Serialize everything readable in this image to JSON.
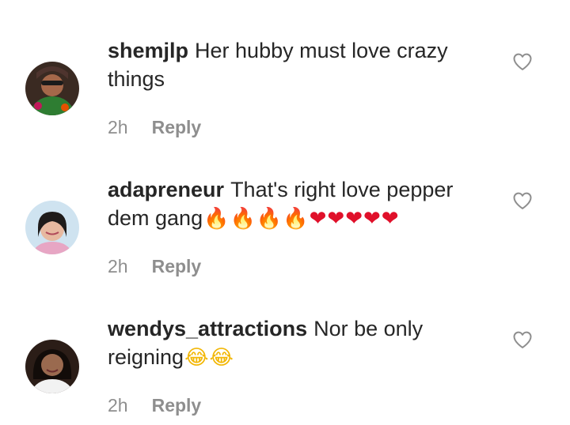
{
  "comments": [
    {
      "username": "shemjlp",
      "text": "Her hubby must love crazy things",
      "emojis": [],
      "time": "2h",
      "reply_label": "Reply",
      "like_icon": "heart-outline-icon"
    },
    {
      "username": "adapreneur",
      "text": "That's right love pepper dem gang",
      "emojis": [
        "🔥",
        "🔥",
        "🔥",
        "🔥",
        "❤",
        "❤",
        "❤",
        "❤",
        "❤"
      ],
      "time": "2h",
      "reply_label": "Reply",
      "like_icon": "heart-outline-icon"
    },
    {
      "username": "wendys_attractions",
      "text": "Nor be only reigning",
      "emojis": [
        "😂",
        "😂"
      ],
      "time": "2h",
      "reply_label": "Reply",
      "like_icon": "heart-outline-icon"
    }
  ],
  "colors": {
    "text": "#262626",
    "meta": "#8e8e8e",
    "like_outline": "#8e8e8e"
  }
}
